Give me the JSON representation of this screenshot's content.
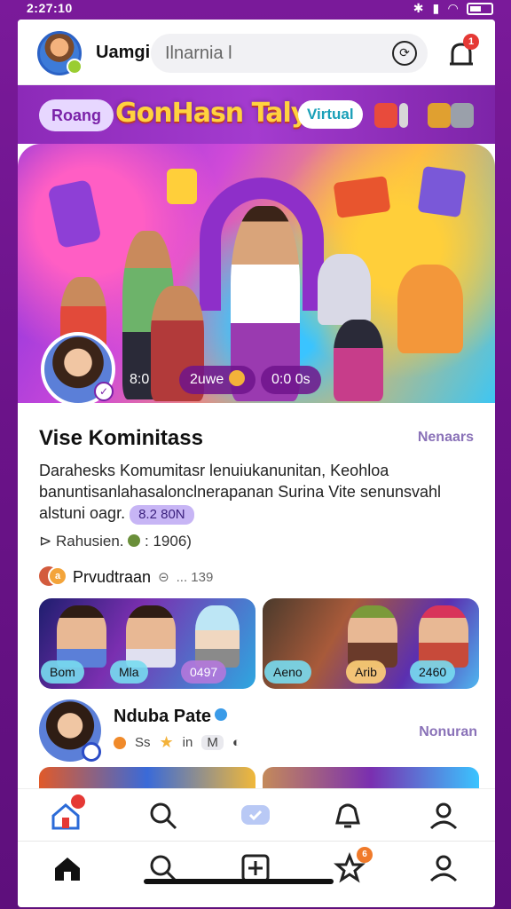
{
  "status_bar": {
    "time": "2:27:10"
  },
  "header": {
    "username": "Uamgi",
    "search_text": "Ilnarnia l"
  },
  "chips": {
    "primary": "Roang",
    "brand": "GonHasn Taly",
    "virtual": "Virtual"
  },
  "hero": {
    "pill_left": "8:0",
    "pill_middle": "2uwe",
    "pill_right": "0:0 0s"
  },
  "community": {
    "title": "Vise Kominitass",
    "more": "Nenaars",
    "description": "Darahesks Komumitasr lenuiukanunitan, Keohloa banuntisanlahasalonclnerapanan Surina Vite senunsvahl alstuni oagr.",
    "description_tag": "8.2 80N",
    "meta_label": "Rahusien.",
    "meta_value": ": 1906)",
    "producer_label": "Prvudtraan",
    "producer_count": "... 139",
    "producer_badge": "a"
  },
  "tiles": [
    {
      "tag1": "Bom",
      "tag2": "Mla",
      "tag3": "0497"
    },
    {
      "tag1": "Aeno",
      "tag2": "Arib",
      "tag3": "2460"
    }
  ],
  "profile": {
    "name": "Nduba Pate",
    "stat1": "Ss",
    "stat2": "in",
    "stat3": "M",
    "more": "Nonuran"
  },
  "tabbar_top": [
    "home-alt-icon",
    "search-icon",
    "chat-icon",
    "bell-icon",
    "profile-icon"
  ],
  "tabbar_bottom": [
    "home-icon",
    "search-icon",
    "add-icon",
    "star-notif-icon",
    "profile-icon"
  ],
  "colors": {
    "accent_purple": "#7a1a9a",
    "brand_yellow": "#ffd23f",
    "link_purple": "#8a72b8",
    "notif_red": "#e53935"
  }
}
